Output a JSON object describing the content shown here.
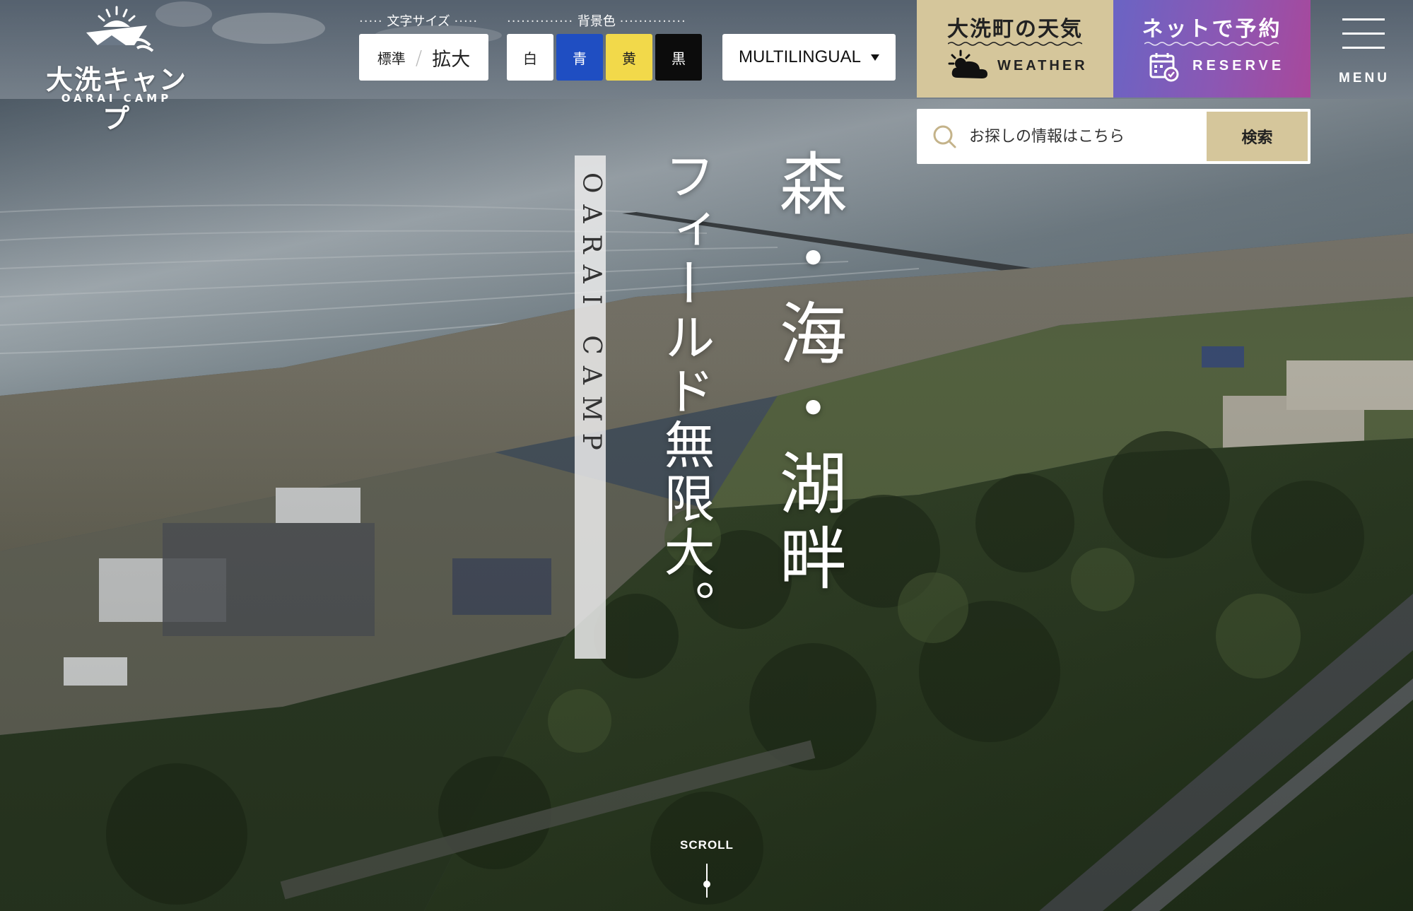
{
  "logo": {
    "title": "大洗キャンプ",
    "subtitle": "OARAI CAMP"
  },
  "accessibility": {
    "font_size_label": "文字サイズ",
    "font_size_options": {
      "normal": "標準",
      "large": "拡大"
    },
    "bg_color_label": "背景色",
    "bg_color_options": {
      "white": "白",
      "blue": "青",
      "yellow": "黄",
      "black": "黒"
    }
  },
  "language": {
    "label": "MULTILINGUAL"
  },
  "weather": {
    "title_jp": "大洗町の天気",
    "title_en": "WEATHER"
  },
  "reserve": {
    "title_jp": "ネットで予約",
    "title_en": "RESERVE"
  },
  "menu": {
    "label": "MENU"
  },
  "search": {
    "placeholder": "お探しの情報はこちら",
    "button": "検索"
  },
  "hero": {
    "catch_main": "森・海・湖畔",
    "catch_sub": "フィールド無限大。",
    "brand_vertical": "OARAI CAMP",
    "scroll_label": "SCROLL"
  },
  "colors": {
    "weather_bg": "#d5c69b",
    "reserve_gradient_start": "#6a64c4",
    "reserve_gradient_end": "#a8489b",
    "bg_blue": "#1f4ec2",
    "bg_yellow": "#f2d94a",
    "bg_black": "#0c0c0c"
  },
  "icons": [
    "sun-ship-logo-icon",
    "cloud-sun-icon",
    "calendar-check-icon",
    "search-icon",
    "hamburger-menu-icon",
    "dropdown-triangle-icon"
  ]
}
